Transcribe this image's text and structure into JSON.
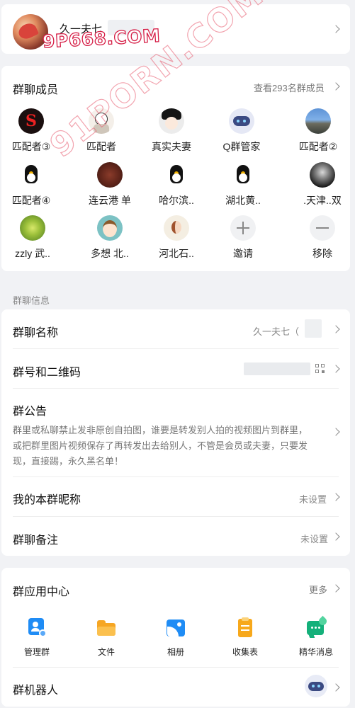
{
  "header": {
    "group_name": "久一夫七",
    "watermark": "9P668.COM"
  },
  "watermark_diag": "91PORN.COM",
  "members": {
    "title": "群聊成员",
    "view_all": "查看293名群成员",
    "items": [
      {
        "name": "匹配者③",
        "avatar": "letter-s-avatar"
      },
      {
        "name": "匹配者",
        "avatar": "cartoon-girl-avatar"
      },
      {
        "name": "真实夫妻",
        "avatar": "anime-boy-avatar"
      },
      {
        "name": "Q群管家",
        "avatar": "robot-avatar"
      },
      {
        "name": "匹配者②",
        "avatar": "landscape-avatar"
      },
      {
        "name": "匹配者④",
        "avatar": "qq-penguin-avatar"
      },
      {
        "name": "连云港 单",
        "avatar": "food-avatar"
      },
      {
        "name": "哈尔滨..",
        "avatar": "qq-penguin-avatar"
      },
      {
        "name": "湖北黄..",
        "avatar": "qq-penguin-avatar"
      },
      {
        "name": ".天津..双",
        "avatar": "dark-photo-avatar"
      },
      {
        "name": "zzly  武..",
        "avatar": "flower-avatar"
      },
      {
        "name": "多想 北..",
        "avatar": "cartoon-boy-avatar"
      },
      {
        "name": "河北石..",
        "avatar": "drawn-portrait-avatar"
      },
      {
        "name": "邀请",
        "avatar": "plus-icon"
      },
      {
        "name": "移除",
        "avatar": "minus-icon"
      }
    ]
  },
  "info": {
    "section_label": "群聊信息",
    "name_label": "群聊名称",
    "name_value": "久一夫七（",
    "number_label": "群号和二维码",
    "notice_label": "群公告",
    "notice_text": "群里或私聊禁止发非原创自拍图，谁要是转发别人拍的视频图片到群里，或把群里图片视频保存了再转发出去给别人，不管是会员或夫妻，只要发现，直接踢，永久黑名单！",
    "nickname_label": "我的本群昵称",
    "nickname_value": "未设置",
    "remark_label": "群聊备注",
    "remark_value": "未设置"
  },
  "apps": {
    "title": "群应用中心",
    "more": "更多",
    "items": [
      {
        "label": "管理群",
        "icon": "manage-group-icon",
        "color": "#1f8cf5"
      },
      {
        "label": "文件",
        "icon": "folder-icon",
        "color": "#f6a623"
      },
      {
        "label": "相册",
        "icon": "album-icon",
        "color": "#1f8cf5"
      },
      {
        "label": "收集表",
        "icon": "clipboard-icon",
        "color": "#f7a81b"
      },
      {
        "label": "精华消息",
        "icon": "highlight-message-icon",
        "color": "#14b07a"
      }
    ],
    "robot_label": "群机器人"
  }
}
